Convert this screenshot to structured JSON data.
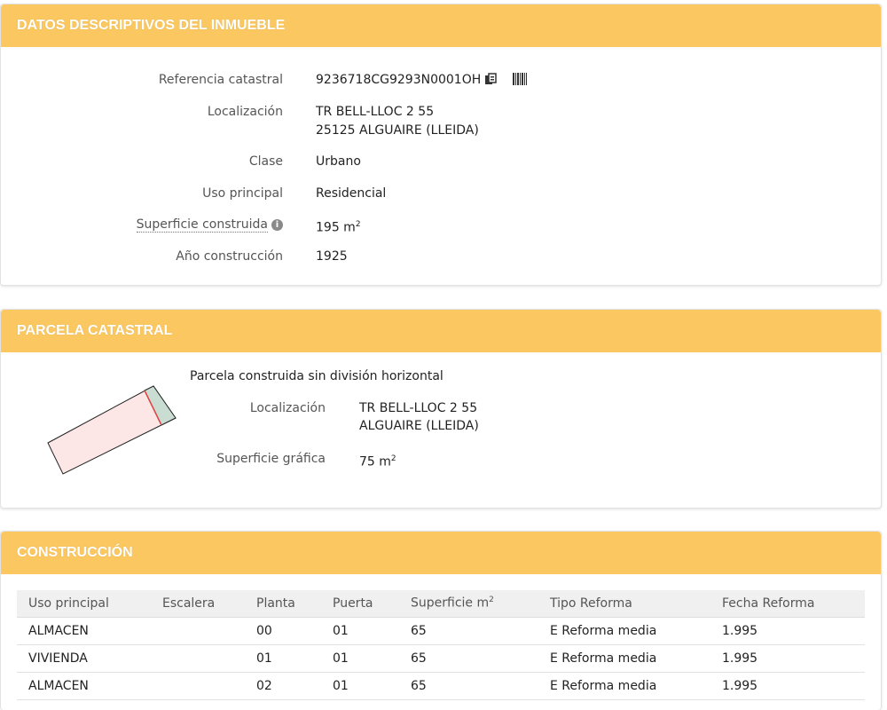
{
  "datos": {
    "title": "DATOS DESCRIPTIVOS DEL INMUEBLE",
    "referencia_label": "Referencia catastral",
    "referencia_value": "9236718CG9293N0001OH",
    "localizacion_label": "Localización",
    "localizacion_line1": "TR BELL-LLOC 2 55",
    "localizacion_line2": "25125 ALGUAIRE (LLEIDA)",
    "clase_label": "Clase",
    "clase_value": "Urbano",
    "uso_label": "Uso principal",
    "uso_value": "Residencial",
    "superficie_label": "Superficie construida",
    "superficie_value": "195 m",
    "superficie_sup": "2",
    "anio_label": "Año construcción",
    "anio_value": "1925"
  },
  "parcela": {
    "title": "PARCELA CATASTRAL",
    "description": "Parcela construida sin división horizontal",
    "localizacion_label": "Localización",
    "localizacion_line1": "TR BELL-LLOC 2 55",
    "localizacion_line2": "ALGUAIRE (LLEIDA)",
    "superficie_label": "Superficie gráfica",
    "superficie_value": "75 m",
    "superficie_sup": "2"
  },
  "construccion": {
    "title": "CONSTRUCCIÓN",
    "columns": [
      "Uso principal",
      "Escalera",
      "Planta",
      "Puerta",
      "Superficie m",
      "Tipo Reforma",
      "Fecha Reforma"
    ],
    "superficie_sup": "2",
    "rows": [
      [
        "ALMACEN",
        "",
        "00",
        "01",
        "65",
        "E Reforma media",
        "1.995"
      ],
      [
        "VIVIENDA",
        "",
        "01",
        "01",
        "65",
        "E Reforma media",
        "1.995"
      ],
      [
        "ALMACEN",
        "",
        "02",
        "01",
        "65",
        "E Reforma media",
        "1.995"
      ]
    ]
  },
  "icons": {
    "copy": "copy-icon",
    "barcode": "barcode-icon",
    "info": "info-icon"
  },
  "colors": {
    "header_bg": "#fbc760",
    "parcel_fill": "#fde6e6",
    "parcel_annex": "#c9ddd3",
    "parcel_divider": "#e04545"
  }
}
